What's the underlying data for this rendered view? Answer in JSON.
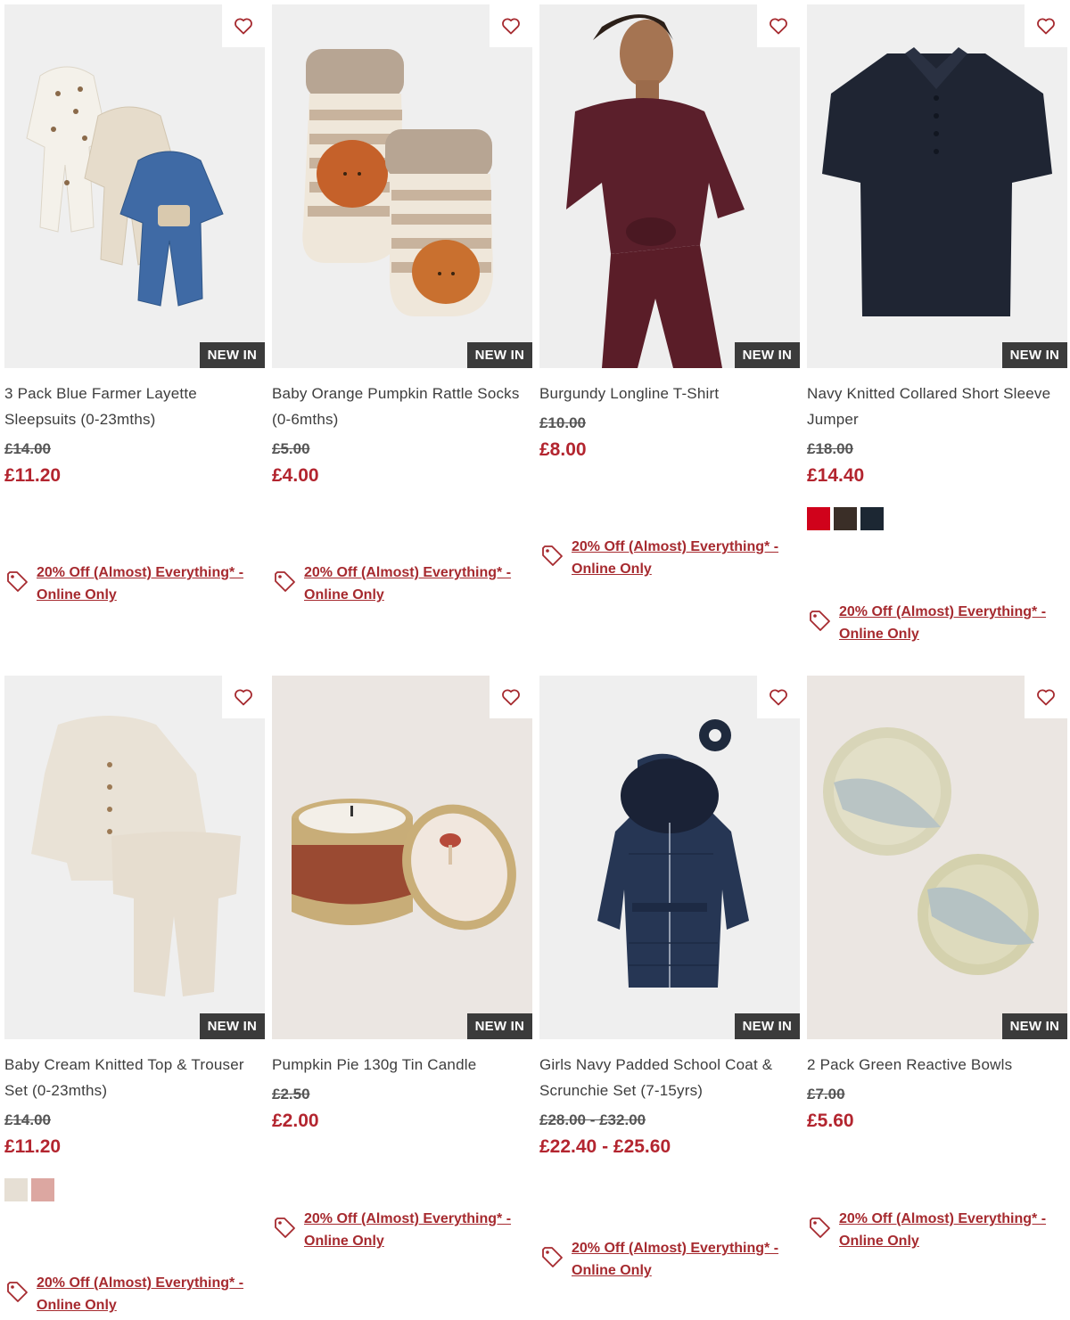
{
  "colors": {
    "accent": "#b3252f",
    "badge_bg": "#3b3b3b",
    "promo": "#a62a2f"
  },
  "badge_label": "NEW IN",
  "promo_text": "20% Off (Almost) Everything* - Online Only",
  "products": [
    {
      "title": "3 Pack Blue Farmer Layette Sleepsuits (0-23mths)",
      "was": "£14.00",
      "now": "£11.20",
      "swatches": []
    },
    {
      "title": "Baby Orange Pumpkin Rattle Socks (0-6mths)",
      "was": "£5.00",
      "now": "£4.00",
      "swatches": []
    },
    {
      "title": "Burgundy Longline T-Shirt",
      "was": "£10.00",
      "now": "£8.00",
      "swatches": []
    },
    {
      "title": "Navy Knitted Collared Short Sleeve Jumper",
      "was": "£18.00",
      "now": "£14.40",
      "swatches": [
        "#d0021b",
        "#3a2e27",
        "#1c2733"
      ]
    },
    {
      "title": "Baby Cream Knitted Top & Trouser Set (0-23mths)",
      "was": "£14.00",
      "now": "£11.20",
      "swatches": [
        "#e6dfd4",
        "#dca7a1"
      ]
    },
    {
      "title": "Pumpkin Pie 130g Tin Candle",
      "was": "£2.50",
      "now": "£2.00",
      "swatches": []
    },
    {
      "title": "Girls Navy Padded School Coat & Scrunchie Set (7-15yrs)",
      "was": "£28.00 - £32.00",
      "now": "£22.40 - £25.60",
      "swatches": []
    },
    {
      "title": "2 Pack Green Reactive Bowls",
      "was": "£7.00",
      "now": "£5.60",
      "swatches": []
    }
  ]
}
